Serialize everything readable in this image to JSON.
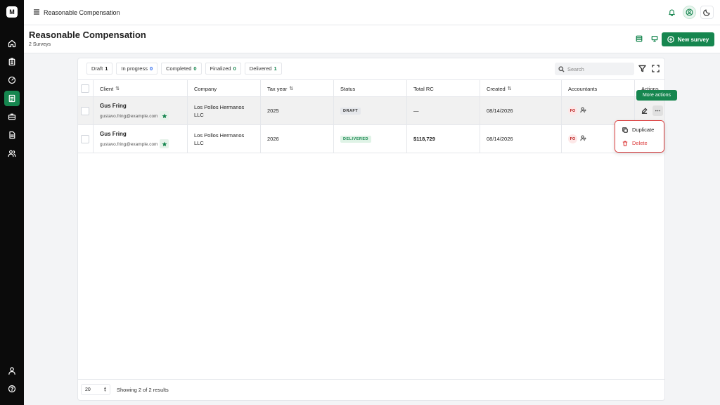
{
  "app": {
    "logo_letter": "M"
  },
  "topbar": {
    "breadcrumb": "Reasonable Compensation"
  },
  "page": {
    "title": "Reasonable Compensation",
    "subtitle": "2 Surveys",
    "new_button_label": "New survey"
  },
  "filters": [
    {
      "label": "Draft",
      "count": "1"
    },
    {
      "label": "In progress",
      "count": "0"
    },
    {
      "label": "Completed",
      "count": "0"
    },
    {
      "label": "Finalized",
      "count": "0"
    },
    {
      "label": "Delivered",
      "count": "1"
    }
  ],
  "search": {
    "placeholder": "Search",
    "value": ""
  },
  "table": {
    "columns": {
      "client": "Client",
      "company": "Company",
      "tax_year": "Tax year",
      "status": "Status",
      "total_rc": "Total RC",
      "created": "Created",
      "accountants": "Accountants",
      "actions": "Actions"
    },
    "sort_glyph": "⇅",
    "rows": [
      {
        "client_name": "Gus Fring",
        "client_email": "gustavo.fring@example.com",
        "company_line1": "Los Pollos Hermanos",
        "company_line2": "LLC",
        "tax_year": "2025",
        "status": "DRAFT",
        "total_rc": "—",
        "created": "08/14/2026",
        "accountant_initials": "FO"
      },
      {
        "client_name": "Gus Fring",
        "client_email": "gustavo.fring@example.com",
        "company_line1": "Los Pollos Hermanos",
        "company_line2": "LLC",
        "tax_year": "2026",
        "status": "DELIVERED",
        "total_rc": "$118,729",
        "created": "08/14/2026",
        "accountant_initials": "FO"
      }
    ]
  },
  "tooltip": {
    "text": "More actions"
  },
  "menu": {
    "duplicate": "Duplicate",
    "delete": "Delete"
  },
  "footer": {
    "page_size": "20",
    "showing": "Showing 2 of 2 results"
  },
  "colors": {
    "accent": "#16864f",
    "danger": "#dc3b3b",
    "info": "#2563eb"
  }
}
